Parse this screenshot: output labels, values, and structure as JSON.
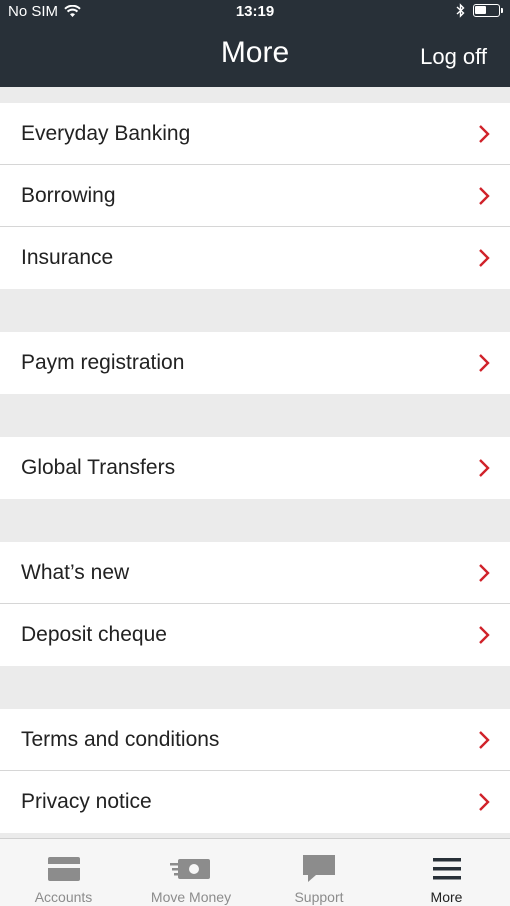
{
  "status_bar": {
    "carrier": "No SIM",
    "time": "13:19"
  },
  "header": {
    "title": "More",
    "logoff_label": "Log off"
  },
  "menu": {
    "items": [
      {
        "label": "Everyday Banking"
      },
      {
        "label": "Borrowing"
      },
      {
        "label": "Insurance"
      },
      {
        "label": "Paym registration"
      },
      {
        "label": "Global Transfers"
      },
      {
        "label": "What’s new"
      },
      {
        "label": "Deposit cheque"
      },
      {
        "label": "Terms and conditions"
      },
      {
        "label": "Privacy notice"
      }
    ]
  },
  "tabs": [
    {
      "label": "Accounts",
      "icon": "card-icon",
      "active": false
    },
    {
      "label": "Move Money",
      "icon": "money-icon",
      "active": false
    },
    {
      "label": "Support",
      "icon": "chat-bubble-icon",
      "active": false
    },
    {
      "label": "More",
      "icon": "menu-icon",
      "active": true
    }
  ],
  "colors": {
    "header_bg": "#283038",
    "chevron": "#d0222a",
    "separator_bg": "#ebebeb"
  }
}
